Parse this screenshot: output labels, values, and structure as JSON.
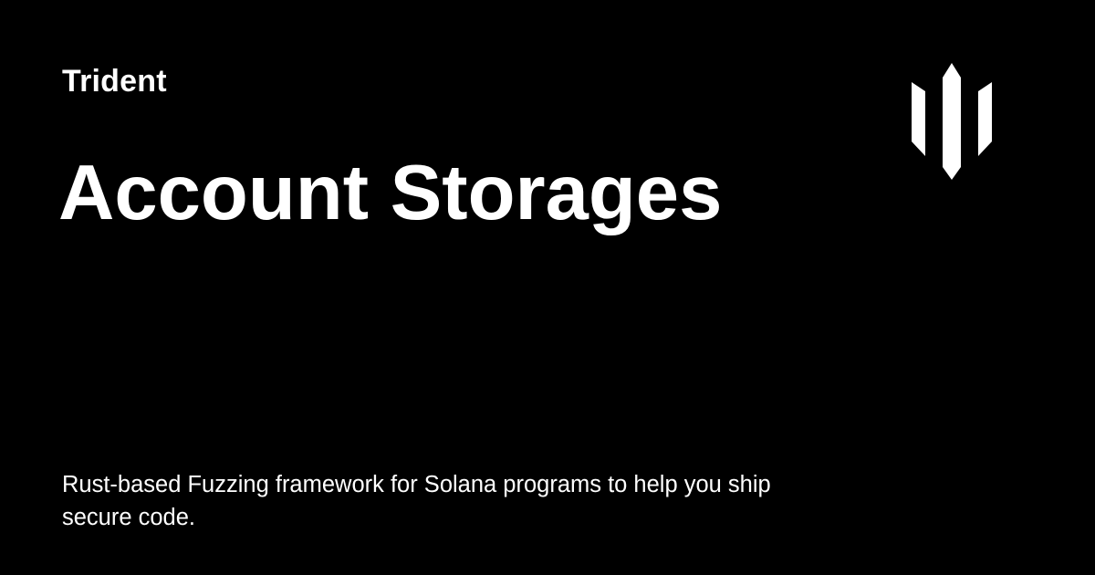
{
  "card": {
    "background_color": "#000000",
    "text_color": "#ffffff",
    "site_name": "Trident",
    "title": "Account Storages",
    "description": "Rust-based Fuzzing framework for Solana programs to help you ship secure code.",
    "logo_icon": "trident-logo-icon"
  }
}
